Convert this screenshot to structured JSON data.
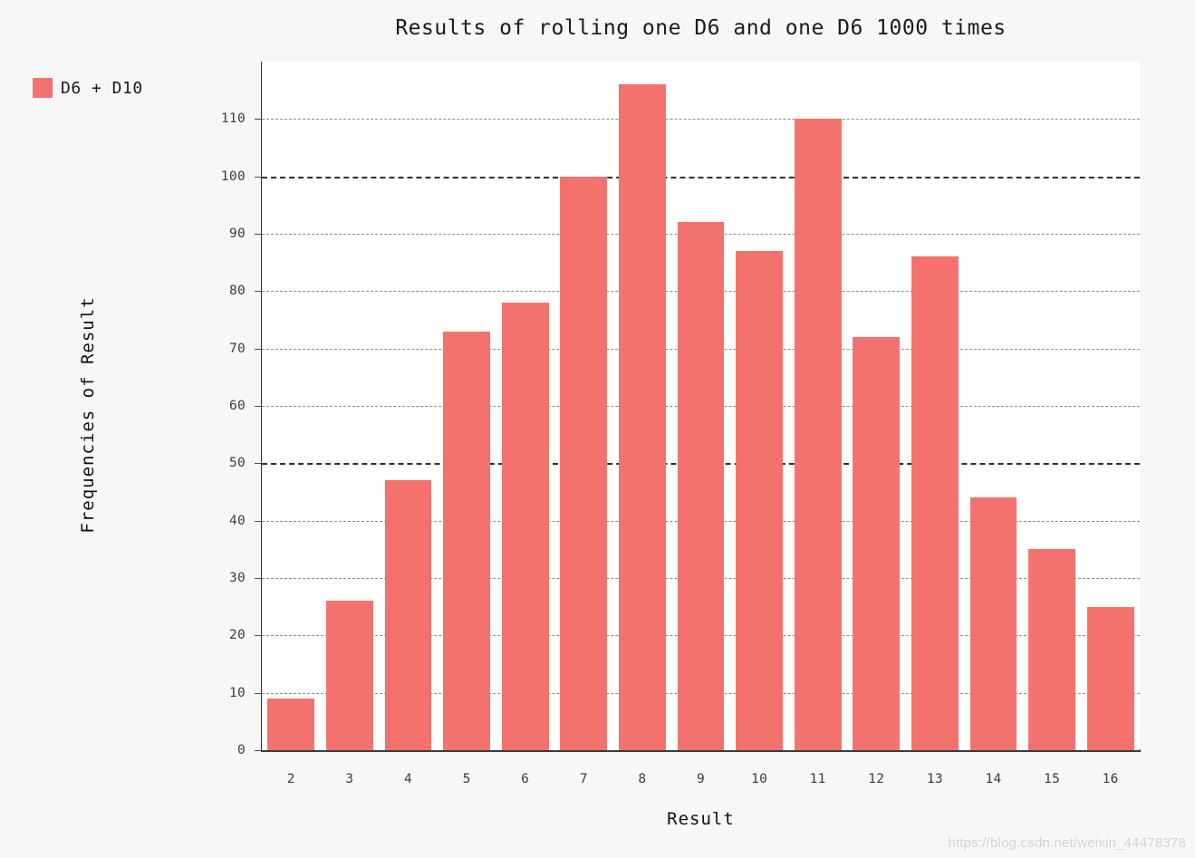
{
  "chart_data": {
    "type": "bar",
    "title": "Results of rolling one D6 and one D6 1000 times",
    "xlabel": "Result",
    "ylabel": "Frequencies of Result",
    "categories": [
      "2",
      "3",
      "4",
      "5",
      "6",
      "7",
      "8",
      "9",
      "10",
      "11",
      "12",
      "13",
      "14",
      "15",
      "16"
    ],
    "values": [
      9,
      26,
      47,
      73,
      78,
      100,
      116,
      92,
      87,
      110,
      72,
      86,
      44,
      35,
      25
    ],
    "series": [
      {
        "name": "D6 + D10",
        "color": "#f4726e",
        "values": [
          9,
          26,
          47,
          73,
          78,
          100,
          116,
          92,
          87,
          110,
          72,
          86,
          44,
          35,
          25
        ]
      }
    ],
    "ylim": [
      0,
      120
    ],
    "yticks": [
      0,
      10,
      20,
      30,
      40,
      50,
      60,
      70,
      80,
      90,
      100,
      110
    ],
    "ytick_labels": [
      "0",
      "10",
      "20",
      "30",
      "40",
      "50",
      "60",
      "70",
      "80",
      "90",
      "100",
      "110"
    ],
    "major_gridlines": [
      50,
      100
    ],
    "grid": true,
    "grid_style": "dashed",
    "legend": {
      "position": "top-left-outside",
      "entries": [
        {
          "label": "D6 + D10",
          "color": "#f4726e"
        }
      ]
    },
    "colors": {
      "bar": "#f4726e",
      "page_background": "#f7f7f7",
      "plot_background": "#ffffff",
      "axis": "#2b2b2b",
      "gridline": "#8a8a93",
      "gridline_major": "#2e2e2e",
      "tick_label": "#3c3c3c",
      "title": "#1a1a1a"
    }
  },
  "watermark": {
    "text": "https://blog.csdn.net/weixin_44478378"
  }
}
